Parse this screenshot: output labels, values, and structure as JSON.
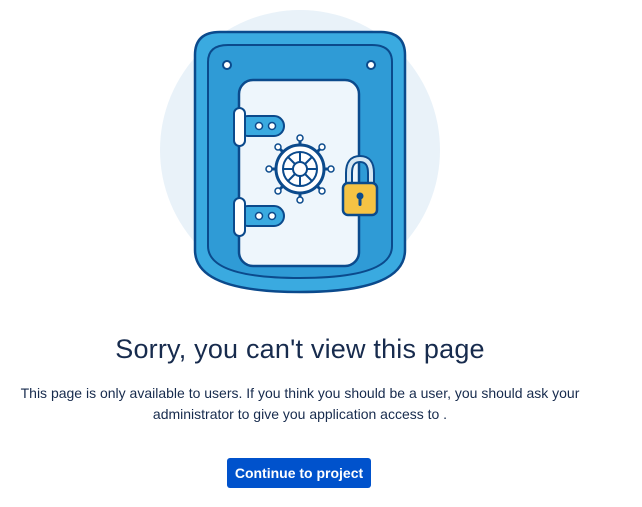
{
  "error": {
    "title": "Sorry, you can't view this page",
    "message": "This page is only available to users. If you think you should be a user, you should ask your administrator to give you application access to .",
    "button_label": "Continue to project"
  },
  "colors": {
    "primary_button": "#0052cc",
    "heading_text": "#172b4d",
    "vault_blue": "#3aaae0",
    "vault_outline": "#0b4a8c",
    "padlock_gold": "#f5c344",
    "backdrop": "#e9f2f9"
  },
  "icons": {
    "illustration": "locked-vault-icon"
  }
}
